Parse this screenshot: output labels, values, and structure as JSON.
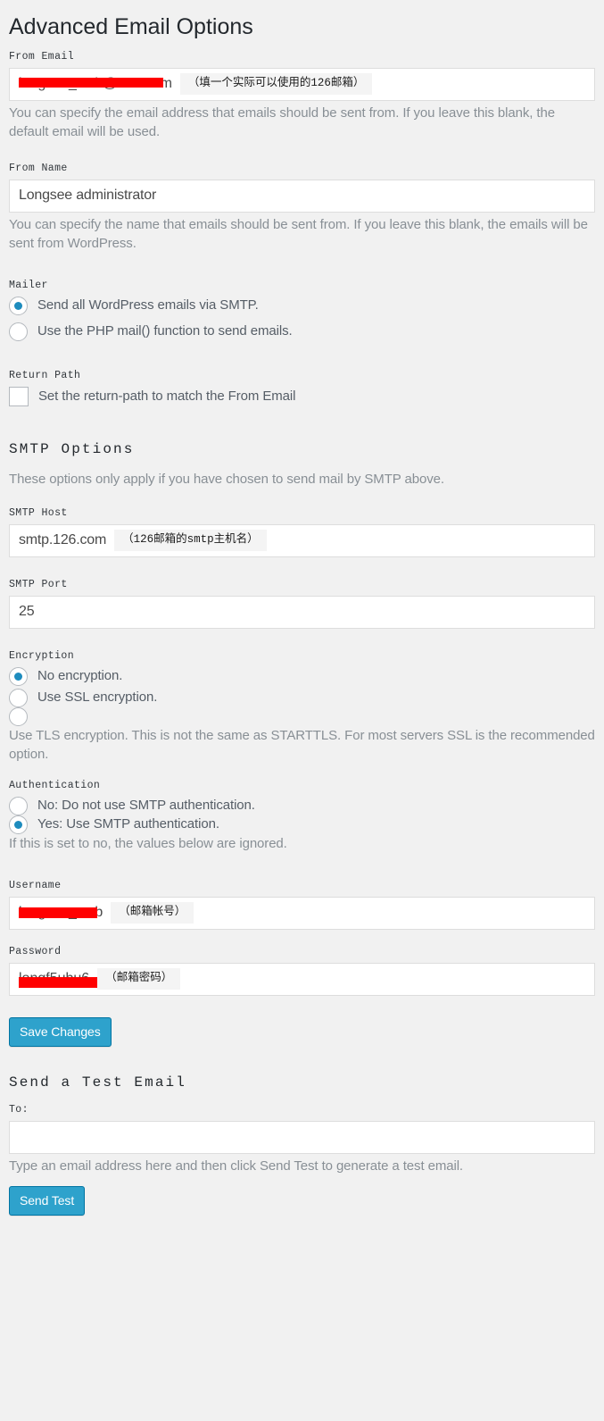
{
  "page": {
    "title": "Advanced Email Options"
  },
  "from_email": {
    "label": "From Email",
    "value_redacted": "longsee_web@126.com",
    "annotation": "（填一个实际可以使用的126邮箱）",
    "description": "You can specify the email address that emails should be sent from. If you leave this blank, the default email will be used."
  },
  "from_name": {
    "label": "From Name",
    "value": "Longsee administrator",
    "description": "You can specify the name that emails should be sent from. If you leave this blank, the emails will be sent from WordPress."
  },
  "mailer": {
    "label": "Mailer",
    "options": [
      {
        "label": "Send all WordPress emails via SMTP.",
        "selected": true
      },
      {
        "label": "Use the PHP mail() function to send emails.",
        "selected": false
      }
    ]
  },
  "return_path": {
    "label": "Return Path",
    "checkbox_label": "Set the return-path to match the From Email",
    "checked": false
  },
  "smtp_options": {
    "heading": "SMTP Options",
    "description": "These options only apply if you have chosen to send mail by SMTP above."
  },
  "smtp_host": {
    "label": "SMTP Host",
    "value": "smtp.126.com",
    "annotation": "（126邮箱的smtp主机名）"
  },
  "smtp_port": {
    "label": "SMTP Port",
    "value": "25"
  },
  "encryption": {
    "label": "Encryption",
    "options": [
      {
        "label": "No encryption.",
        "selected": true
      },
      {
        "label": "Use SSL encryption.",
        "selected": false
      },
      {
        "label": "",
        "selected": false
      }
    ],
    "description": "Use TLS encryption. This is not the same as STARTTLS. For most servers SSL is the recommended option."
  },
  "authentication": {
    "label": "Authentication",
    "options": [
      {
        "label": "No: Do not use SMTP authentication.",
        "selected": false
      },
      {
        "label": "Yes: Use SMTP authentication.",
        "selected": true
      }
    ],
    "description": "If this is set to no, the values below are ignored."
  },
  "username": {
    "label": "Username",
    "value_redacted": "longsee_web",
    "annotation": "（邮箱帐号）"
  },
  "password": {
    "label": "Password",
    "value_redacted": "longf5ubu6",
    "annotation": "（邮箱密码）"
  },
  "buttons": {
    "save_changes": "Save Changes",
    "send_test": "Send Test"
  },
  "test_email": {
    "heading": "Send a Test Email",
    "to_label": "To:",
    "to_value": "",
    "description": "Type an email address here and then click Send Test to generate a test email."
  },
  "colors": {
    "accent": "#2ea2cc",
    "accent_border": "#0074a2",
    "radio_selected": "#1e8cbe",
    "redaction": "#ff0000",
    "background": "#f1f1f1",
    "description_text": "#888f95"
  }
}
